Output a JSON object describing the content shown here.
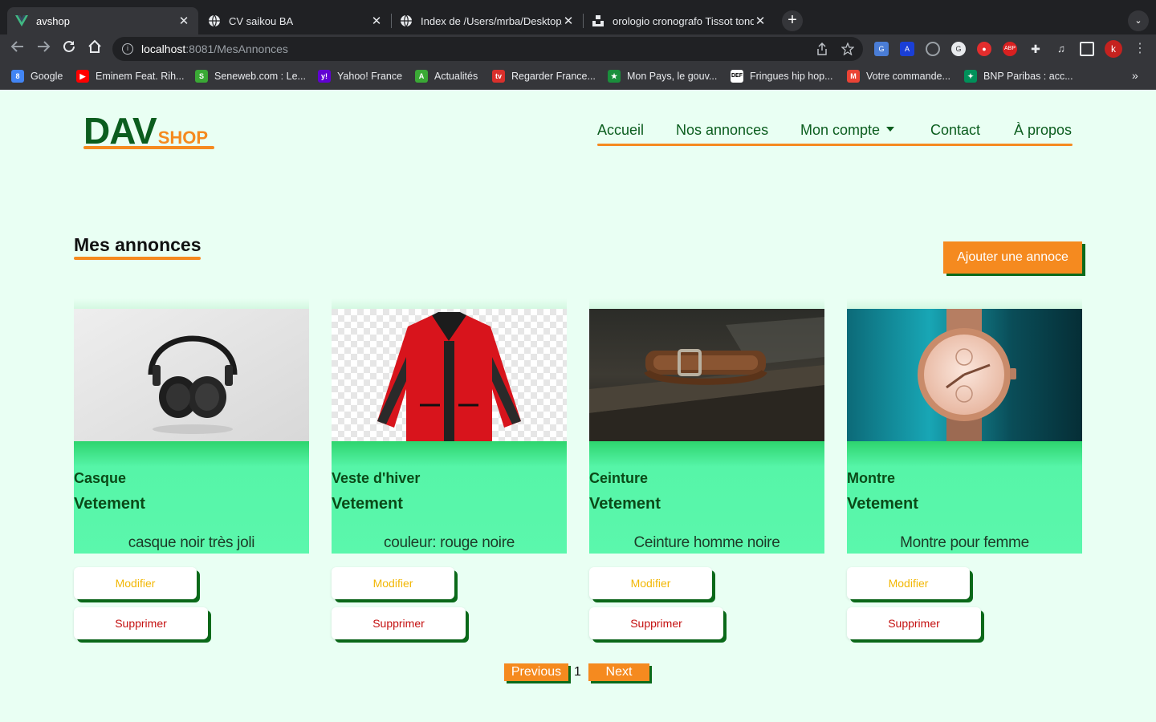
{
  "browser": {
    "tabs": [
      {
        "title": "avshop",
        "favicon": "vue-icon",
        "active": true
      },
      {
        "title": "CV saikou BA",
        "favicon": "globe-icon",
        "active": false
      },
      {
        "title": "Index de /Users/mrba/Desktop/",
        "favicon": "globe-icon",
        "active": false
      },
      {
        "title": "orologio cronografo Tissot tond",
        "favicon": "unsplash-icon",
        "active": false
      }
    ],
    "close_glyph": "✕",
    "new_tab_glyph": "+",
    "tab_menu_glyph": "⌄",
    "address": {
      "host": "localhost",
      "path": ":8081/MesAnnonces"
    },
    "profile_initial": "k",
    "bookmarks": [
      {
        "label": "Google",
        "icon_color": "#4285f4",
        "glyph": "8"
      },
      {
        "label": "Eminem Feat. Rih...",
        "icon_color": "#ff0000",
        "glyph": "▶"
      },
      {
        "label": "Seneweb.com : Le...",
        "icon_color": "#3aa935",
        "glyph": "S"
      },
      {
        "label": "Yahoo! France",
        "icon_color": "#6001d2",
        "glyph": "y!"
      },
      {
        "label": "Actualités",
        "icon_color": "#3aa935",
        "glyph": "A"
      },
      {
        "label": "Regarder France...",
        "icon_color": "#d9302c",
        "glyph": "tv"
      },
      {
        "label": "Mon Pays, le gouv...",
        "icon_color": "#1a8f3c",
        "glyph": "★"
      },
      {
        "label": "Fringues hip hop...",
        "icon_color": "#ffffff",
        "glyph": "DEF"
      },
      {
        "label": "Votre commande...",
        "icon_color": "#ea4335",
        "glyph": "M"
      },
      {
        "label": "BNP Paribas : acc...",
        "icon_color": "#00915a",
        "glyph": "✦"
      }
    ],
    "bookmarks_more": "»"
  },
  "header": {
    "logo_main": "DAV",
    "logo_sub": "SHOP",
    "nav": [
      {
        "label": "Accueil"
      },
      {
        "label": "Nos annonces"
      },
      {
        "label": "Mon compte",
        "dropdown": true
      },
      {
        "label": "Contact"
      },
      {
        "label": "À propos"
      }
    ]
  },
  "page": {
    "title": "Mes annonces",
    "add_button": "Ajouter une annoce"
  },
  "listings": [
    {
      "name": "Casque",
      "category": "Vetement",
      "description": "casque noir très joli",
      "image": "headphones",
      "edit_label": "Modifier",
      "delete_label": "Supprimer"
    },
    {
      "name": "Veste d'hiver",
      "category": "Vetement",
      "description": "couleur: rouge noire",
      "image": "red-jacket",
      "edit_label": "Modifier",
      "delete_label": "Supprimer"
    },
    {
      "name": "Ceinture",
      "category": "Vetement",
      "description": "Ceinture homme noire",
      "image": "leather-belt",
      "edit_label": "Modifier",
      "delete_label": "Supprimer"
    },
    {
      "name": "Montre",
      "category": "Vetement",
      "description": "Montre pour femme",
      "image": "watch",
      "edit_label": "Modifier",
      "delete_label": "Supprimer"
    }
  ],
  "pagination": {
    "previous": "Previous",
    "current": "1",
    "next": "Next"
  },
  "colors": {
    "brand_green": "#0b5d1e",
    "accent_orange": "#f58a1f",
    "card_green": "#5bf7ac",
    "page_bg": "#e9fff3"
  }
}
